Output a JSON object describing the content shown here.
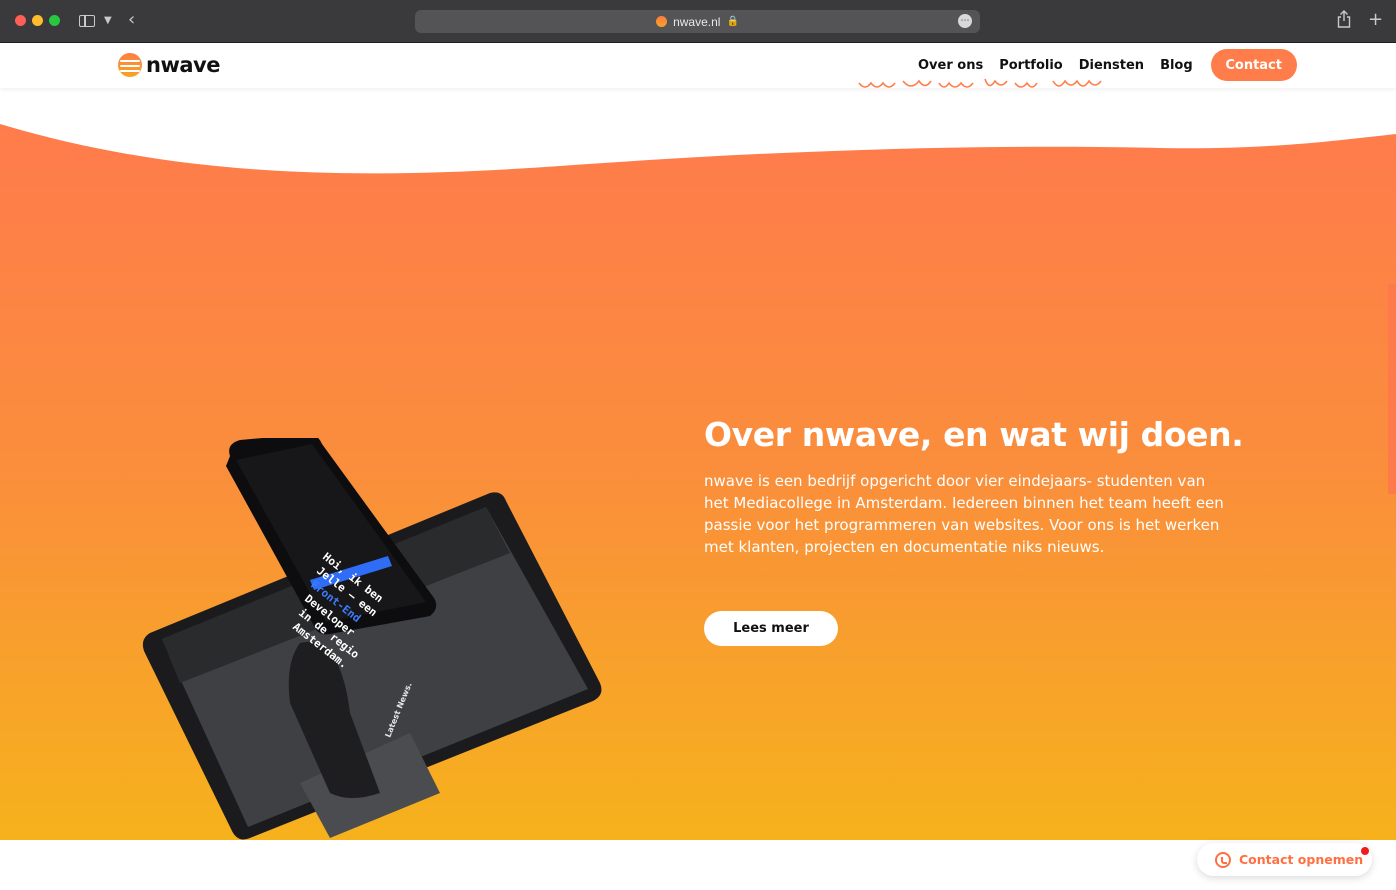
{
  "browser": {
    "url": "nwave.nl"
  },
  "header": {
    "logo_text": "nwave",
    "nav": [
      {
        "label": "Over ons"
      },
      {
        "label": "Portfolio"
      },
      {
        "label": "Diensten"
      },
      {
        "label": "Blog"
      }
    ],
    "contact_label": "Contact"
  },
  "hero": {
    "title": "Over nwave, en wat wij doen.",
    "text": "nwave is een bedrijf opgericht door vier eindejaars- studenten van het Mediacollege in Amsterdam. Iedereen binnen het team heeft een passie voor het programmeren van websites. Voor ons is het werken met klanten, projecten en documentatie niks nieuws.",
    "button_label": "Lees meer",
    "phone_text": [
      "Hoi, ik ben",
      "Jelle — een",
      "Front-End",
      "Developer",
      "in de regio",
      "Amsterdam."
    ],
    "tablet_text": "Latest News."
  },
  "floating": {
    "label": "Contact opnemen"
  },
  "colors": {
    "brand_orange": "#ff7d4a",
    "gradient_top": "#ff7b4c",
    "gradient_bottom": "#f6b21c"
  },
  "icons": {
    "whatsapp": "whatsapp-icon",
    "share": "share-icon",
    "new_tab": "plus-icon"
  }
}
